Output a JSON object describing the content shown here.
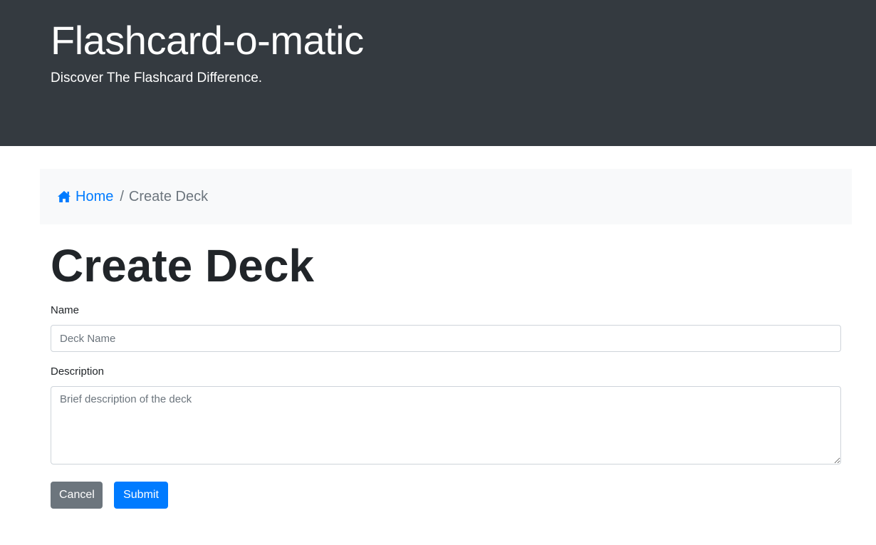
{
  "header": {
    "title": "Flashcard-o-matic",
    "tagline": "Discover The Flashcard Difference.",
    "background_color": "#343a40"
  },
  "breadcrumb": {
    "home_icon": "home-icon",
    "home_label": "Home",
    "separator": "/",
    "current": "Create Deck",
    "link_color": "#007bff"
  },
  "page": {
    "title": "Create Deck"
  },
  "form": {
    "name": {
      "label": "Name",
      "value": "",
      "placeholder": "Deck Name"
    },
    "description": {
      "label": "Description",
      "value": "",
      "placeholder": "Brief description of the deck"
    },
    "cancel_label": "Cancel",
    "submit_label": "Submit",
    "cancel_color": "#6c757d",
    "submit_color": "#007bff"
  }
}
